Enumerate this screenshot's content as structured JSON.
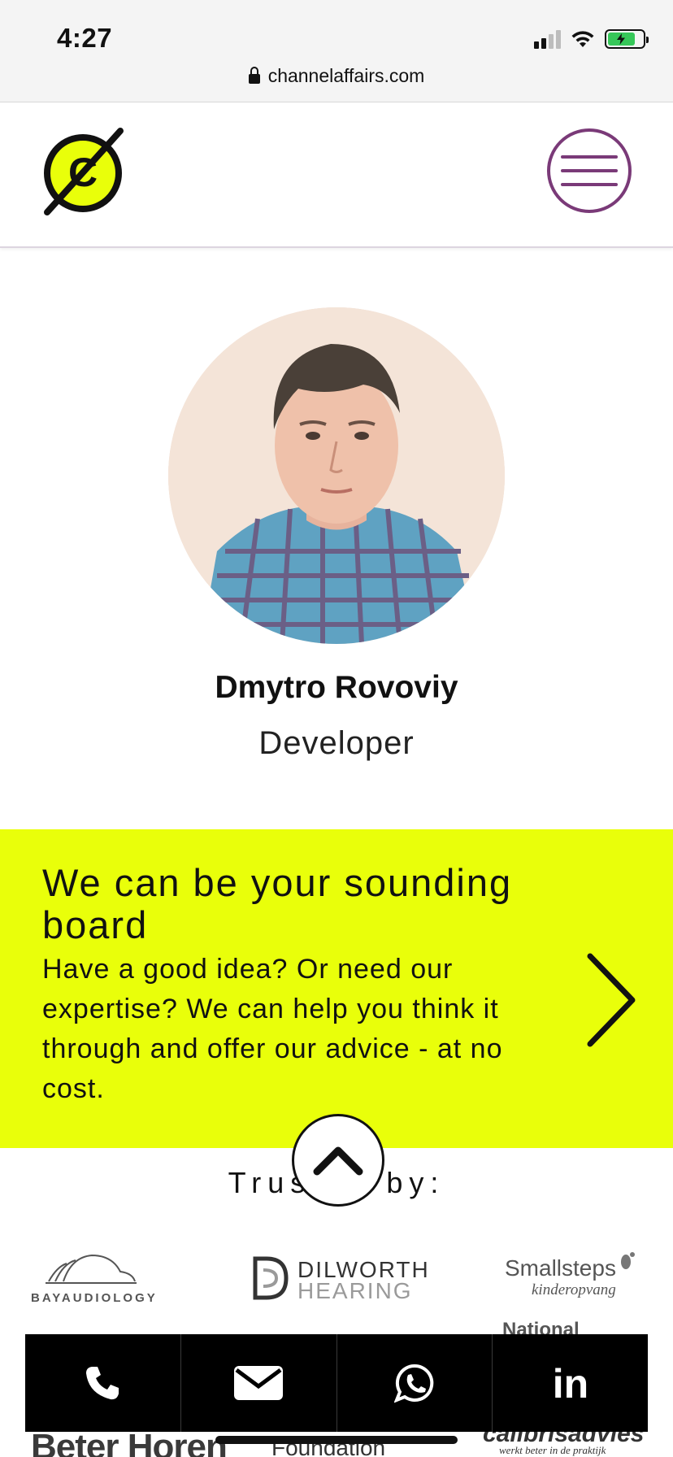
{
  "status_bar": {
    "time": "4:27",
    "url": "channelaffairs.com"
  },
  "header": {
    "logo_letter": "C",
    "brand_color": "#e9ff0a",
    "menu_color": "#7a3a78"
  },
  "profile": {
    "name": "Dmytro Rovoviy",
    "role": "Developer"
  },
  "cta": {
    "title": "We can be your sounding board",
    "text": "Have a good idea? Or need our expertise? We can help you think it through and offer our advice - at no cost.",
    "background": "#e9ff0a"
  },
  "trusted": {
    "label": "Trusted by:",
    "logos": {
      "bay": "BAYAUDIOLOGY",
      "dilworth_line1": "DILWORTH",
      "dilworth_line2": "HEARING",
      "smallsteps_line1": "Smallsteps",
      "smallsteps_line2": "kinderopvang",
      "national": "National",
      "beter": "Beter Horen",
      "foundation": "Foundation",
      "calibris_line1": "calibrisadvies",
      "calibris_line2": "werkt beter in de praktijk"
    }
  },
  "contact_bar": {
    "icons": [
      "phone-icon",
      "mail-icon",
      "whatsapp-icon",
      "linkedin-icon"
    ],
    "linkedin_text": "in"
  }
}
